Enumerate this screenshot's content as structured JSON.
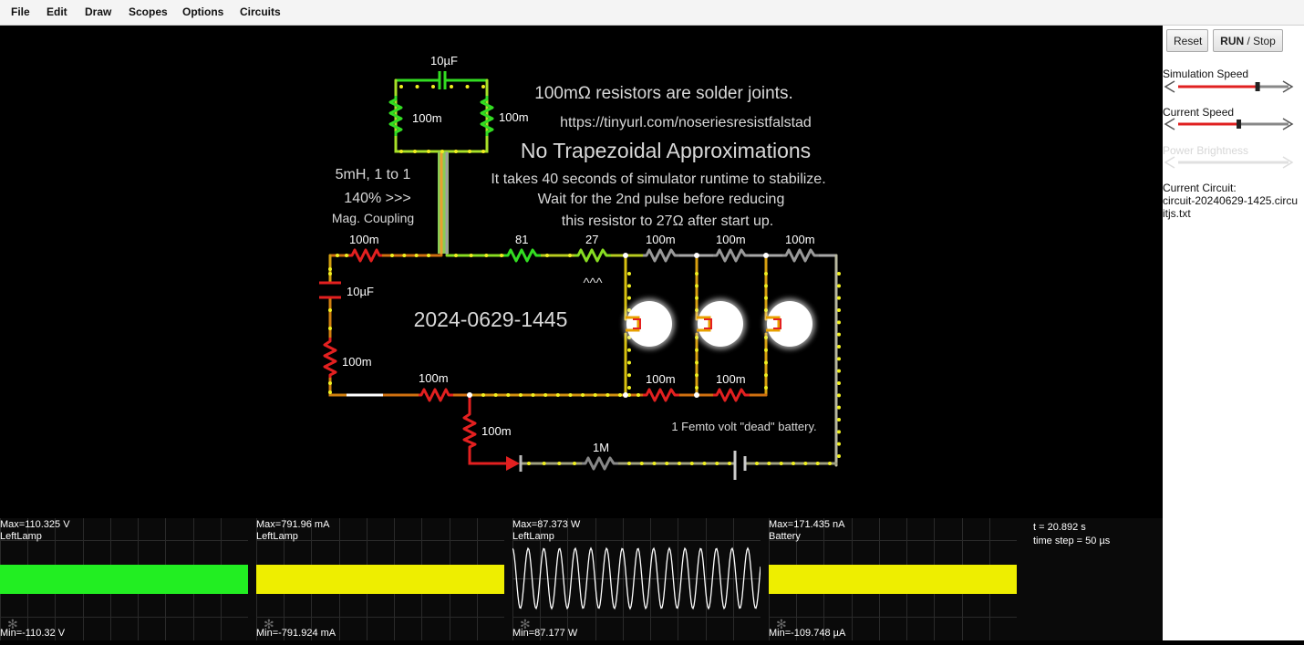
{
  "menu": {
    "items": [
      "File",
      "Edit",
      "Draw",
      "Scopes",
      "Options",
      "Circuits"
    ]
  },
  "sidebar": {
    "reset_label": "Reset",
    "run_label": "RUN",
    "stop_label": " / Stop",
    "simulation_speed_label": "Simulation Speed",
    "current_speed_label": "Current Speed",
    "power_brightness_label": "Power Brightness",
    "simulation_speed_level": 0.72,
    "current_speed_level": 0.55,
    "power_brightness_enabled": false,
    "current_circuit_label": "Current Circuit:",
    "current_circuit_name": "circuit-20240629-1425.circuitjs.txt"
  },
  "circuit": {
    "annotations": {
      "solder_note": "100mΩ resistors are solder joints.",
      "url": "https://tinyurl.com/noseriesresistfalstad",
      "no_trap": "No Trapezoidal Approximations",
      "runtime_note": "It takes 40 seconds of simulator runtime to stabilize.",
      "wait_note": "Wait for the 2nd pulse before reducing",
      "reduce_note": "this resistor to 27Ω after start up.",
      "inductor_line1": "5mH, 1 to 1",
      "inductor_line2": "140% >>>",
      "inductor_line3": "Mag. Coupling",
      "date_label": "2024-0629-1445",
      "battery_note": "1 Femto volt \"dead\" battery.",
      "arrow_note": "^^^"
    },
    "labels": {
      "cap_top": "10µF",
      "res_top_left": "100m",
      "res_top_right": "100m",
      "res_left_top": "100m",
      "cap_left": "10µF",
      "res_left_bottom": "100m",
      "res_bottom_mid": "100m",
      "res_vertical": "100m",
      "res_81": "81",
      "res_27": "27",
      "res_lamp1": "100m",
      "res_lamp2": "100m",
      "res_lamp3": "100m",
      "res_bot_lamp1": "100m",
      "res_bot_lamp2": "100m",
      "res_1M": "1M"
    },
    "colors": {
      "green": "#33dd22",
      "yellow": "#e8e800",
      "red": "#e32020",
      "gray": "#8a8a8a",
      "orange": "#e8a000"
    }
  },
  "scopes": [
    {
      "max": "Max=110.325 V",
      "name": "LeftLamp",
      "min": "Min=-110.32 V",
      "kind": "band",
      "color": "#22ee22"
    },
    {
      "max": "Max=791.96 mA",
      "name": "LeftLamp",
      "min": "Min=-791.924 mA",
      "kind": "band",
      "color": "#eeee00"
    },
    {
      "max": "Max=87.373 W",
      "name": "LeftLamp",
      "min": "Min=87.177 W",
      "kind": "wave",
      "color": "#ffffff"
    },
    {
      "max": "Max=171.435 nA",
      "name": "Battery",
      "min": "Min=-109.748 µA",
      "kind": "band",
      "color": "#eeee00"
    }
  ],
  "sim_info": {
    "time": "t = 20.892 s",
    "timestep": "time step = 50 µs"
  }
}
